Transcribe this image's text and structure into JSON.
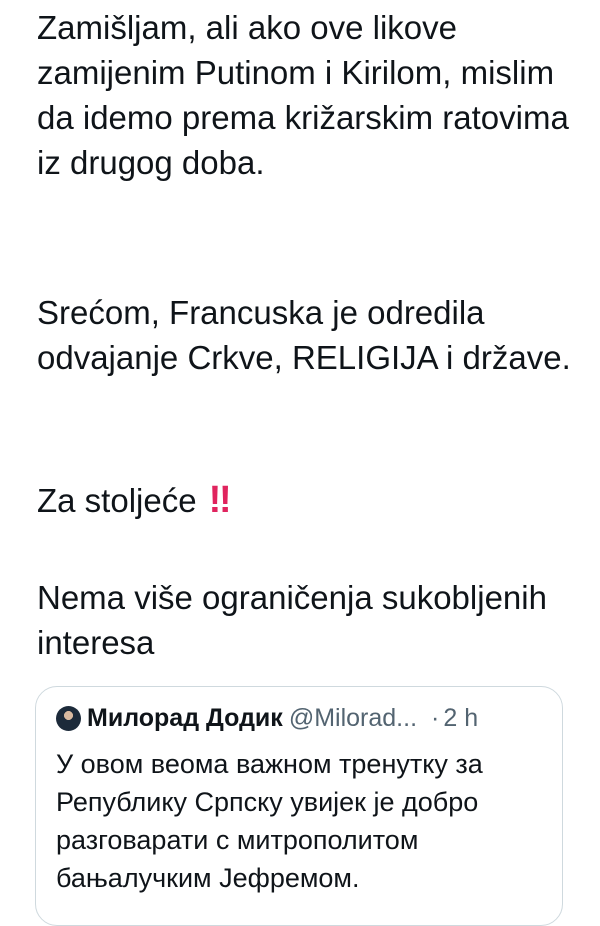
{
  "tweet": {
    "paragraph_1": "Zamišljam, ali ako ove likove zamijenim Putinom i Kirilom, mislim da idemo prema križarskim ratovima iz drugog doba.",
    "paragraph_2": "Srećom, Francuska je odredila odvajanje Crkve, RELIGIJA i države.",
    "paragraph_3": "Za stoljeće",
    "paragraph_3_emoji": "‼",
    "paragraph_4": "Nema više ograničenja sukobljenih interesa"
  },
  "quoted_tweet": {
    "author_name": "Милорад Додик",
    "author_handle": "@Milorad...",
    "separator": "·",
    "time": "2 h",
    "text": "У овом веома важном тренутку за Републику Српску увијек је добро разговарати с митрополитом бањалучким Јефремом.",
    "avatar_icon": "avatar-photo"
  },
  "colors": {
    "text": "#0f1419",
    "secondary_text": "#536471",
    "card_border": "#cfd9de",
    "alarm_red": "#e0245e",
    "background": "#ffffff"
  }
}
